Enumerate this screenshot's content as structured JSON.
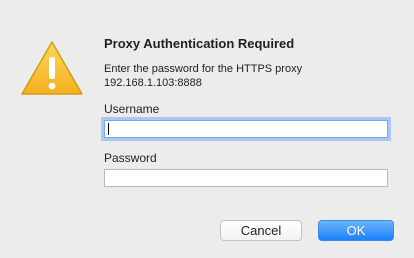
{
  "dialog": {
    "icon": "warning-triangle-icon",
    "title": "Proxy Authentication Required",
    "message_line1": "Enter the password for the HTTPS proxy",
    "message_line2": "192.168.1.103:8888",
    "username_label": "Username",
    "username_value": "",
    "password_label": "Password",
    "password_value": "",
    "cancel_label": "Cancel",
    "ok_label": "OK"
  },
  "colors": {
    "background": "#ececec",
    "accent": "#1a82fb",
    "warning": "#f6c33a"
  }
}
